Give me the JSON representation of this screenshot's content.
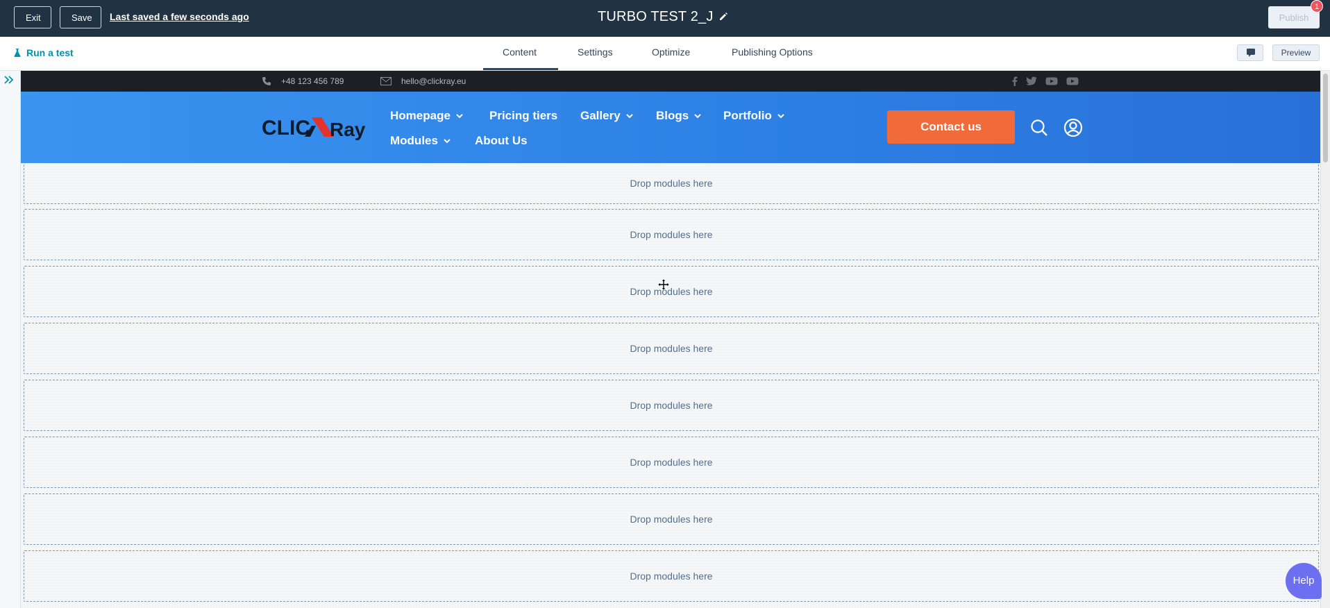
{
  "topbar": {
    "exit_label": "Exit",
    "save_label": "Save",
    "saved_status": "Last saved a few seconds ago",
    "page_title": "TURBO TEST 2_J",
    "publish_label": "Publish",
    "notification_count": "1"
  },
  "subbar": {
    "run_test_label": "Run a test",
    "tabs": [
      {
        "label": "Content",
        "active": true
      },
      {
        "label": "Settings"
      },
      {
        "label": "Optimize"
      },
      {
        "label": "Publishing Options"
      }
    ],
    "preview_label": "Preview"
  },
  "site": {
    "phone": "+48 123 456 789",
    "email": "hello@clickray.eu",
    "social_icons": [
      "facebook-icon",
      "twitter-icon",
      "youtube-icon",
      "youtube-icon"
    ],
    "logo_text": "CLICKRay",
    "nav": [
      {
        "label": "Homepage",
        "has_dropdown": true
      },
      {
        "label": "Pricing tiers",
        "has_dropdown": false
      },
      {
        "label": "Gallery",
        "has_dropdown": true
      },
      {
        "label": "Blogs",
        "has_dropdown": true
      },
      {
        "label": "Portfolio",
        "has_dropdown": true
      },
      {
        "label": "Modules",
        "has_dropdown": true
      },
      {
        "label": "About Us",
        "has_dropdown": false
      }
    ],
    "contact_label": "Contact us",
    "accent_color": "#f06a3a",
    "header_color": "#2d7fe3"
  },
  "dropzones": [
    "Drop modules here",
    "Drop modules here",
    "Drop modules here",
    "Drop modules here",
    "Drop modules here",
    "Drop modules here",
    "Drop modules here",
    "Drop modules here"
  ],
  "help_label": "Help"
}
